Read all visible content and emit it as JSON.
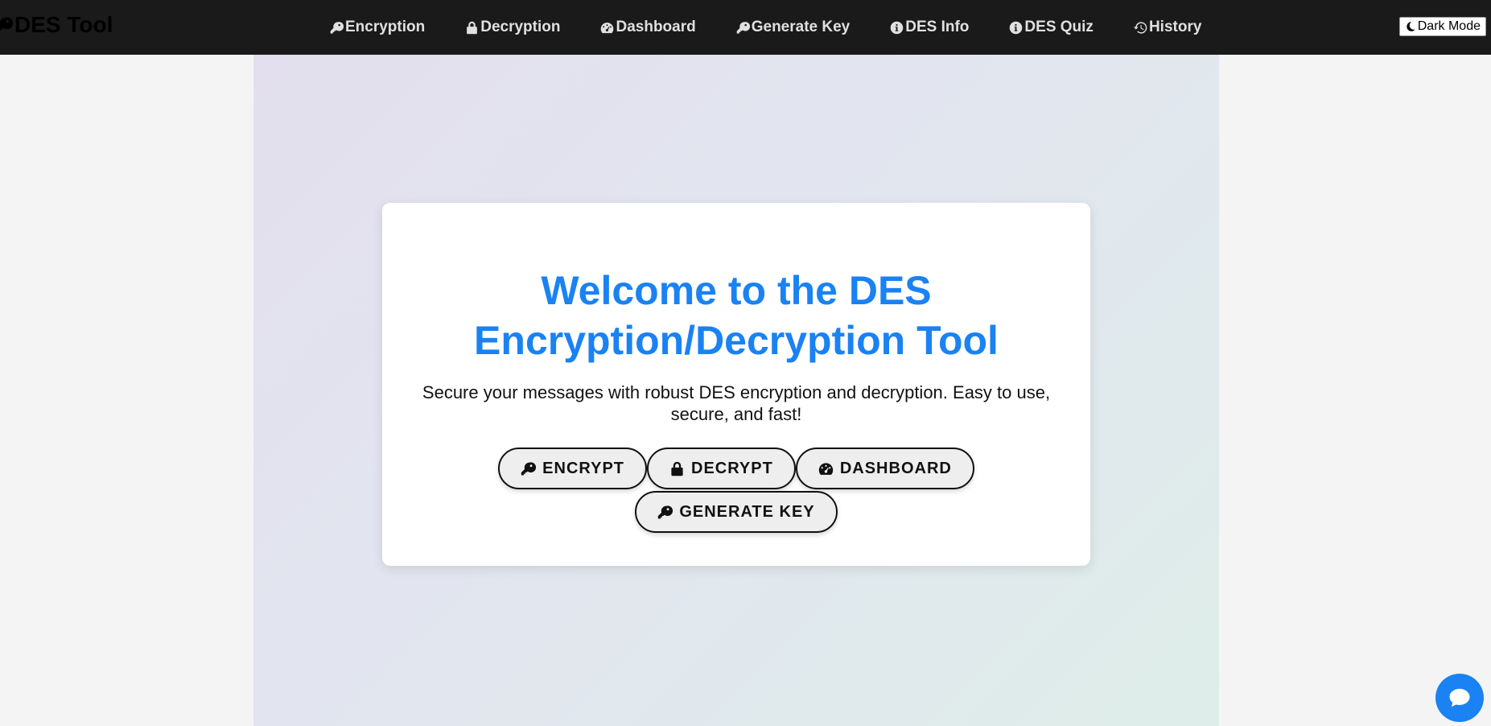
{
  "brand": {
    "title": "DES Tool",
    "icon": "key-icon"
  },
  "nav": {
    "items": [
      {
        "label": "Encryption",
        "icon": "key-icon"
      },
      {
        "label": "Decryption",
        "icon": "lock-icon"
      },
      {
        "label": "Dashboard",
        "icon": "gauge-icon"
      },
      {
        "label": "Generate Key",
        "icon": "key-icon"
      },
      {
        "label": "DES Info",
        "icon": "info-icon"
      },
      {
        "label": "DES Quiz",
        "icon": "info-icon"
      },
      {
        "label": "History",
        "icon": "history-icon"
      }
    ],
    "dark_mode_label": "Dark Mode"
  },
  "hero": {
    "title": "Welcome to the DES Encryption/Decryption Tool",
    "subtitle": "Secure your messages with robust DES encryption and decryption. Easy to use, secure, and fast!",
    "buttons": [
      {
        "label": "ENCRYPT",
        "icon": "key-icon"
      },
      {
        "label": "DECRYPT",
        "icon": "lock-icon"
      },
      {
        "label": "DASHBOARD",
        "icon": "gauge-icon"
      },
      {
        "label": "GENERATE KEY",
        "icon": "key-icon"
      }
    ]
  },
  "chat": {
    "icon": "chat-bubble-icon"
  },
  "colors": {
    "navbar": "#1a1a1a",
    "accent": "#1a82f2",
    "page_background": "#f4f4f4"
  }
}
